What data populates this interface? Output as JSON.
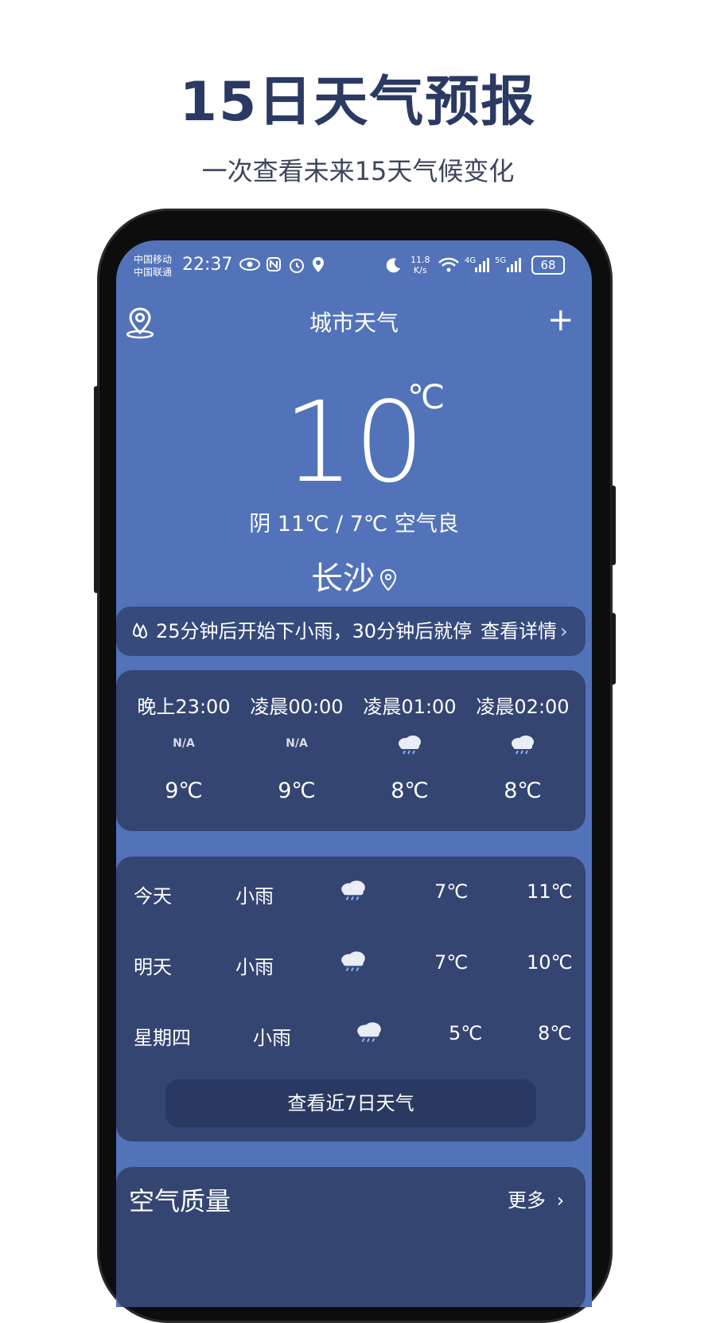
{
  "promo": {
    "title": "15日天气预报",
    "subtitle": "一次查看未来15天气候变化"
  },
  "status_bar": {
    "carrier_1": "中国移动",
    "carrier_2": "中国联通",
    "time": "22:37",
    "speed_value": "11.8",
    "speed_unit": "K/s",
    "net_1": "4G",
    "net_2": "5G",
    "battery": "68"
  },
  "header": {
    "title": "城市天气",
    "add_label": "+"
  },
  "current": {
    "temperature": "10",
    "unit": "℃",
    "summary": "阴  11℃  / 7℃  空气良",
    "city": "长沙"
  },
  "rain_banner": {
    "text": "25分钟后开始下小雨，30分钟后就停",
    "more": "查看详情",
    "chevron": "›"
  },
  "hourly": [
    {
      "time": "晚上23:00",
      "icon": "N/A",
      "icon_name": "na-icon",
      "temp": "9℃"
    },
    {
      "time": "凌晨00:00",
      "icon": "N/A",
      "icon_name": "na-icon",
      "temp": "9℃"
    },
    {
      "time": "凌晨01:00",
      "icon": "",
      "icon_name": "rain-cloud-icon",
      "temp": "8℃"
    },
    {
      "time": "凌晨02:00",
      "icon": "",
      "icon_name": "rain-cloud-icon",
      "temp": "8℃"
    }
  ],
  "daily": [
    {
      "day": "今天",
      "desc": "小雨",
      "icon_name": "rain-cloud-icon",
      "low": "7℃",
      "high": "11℃"
    },
    {
      "day": "明天",
      "desc": "小雨",
      "icon_name": "rain-cloud-icon",
      "low": "7℃",
      "high": "10℃"
    },
    {
      "day": "星期四",
      "desc": "小雨",
      "icon_name": "rain-cloud-icon",
      "low": "5℃",
      "high": "8℃"
    }
  ],
  "daily_button": "查看近7日天气",
  "air_quality": {
    "title": "空气质量",
    "more": "更多",
    "chevron": "›"
  },
  "colors": {
    "screen_bg": "#5273b9",
    "card_bg": "#344572",
    "title_color": "#2b3a63"
  }
}
